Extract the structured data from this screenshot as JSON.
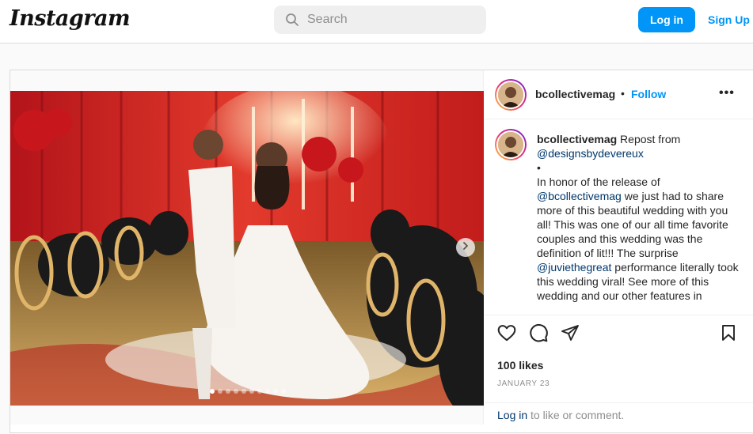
{
  "header": {
    "logo": "Instagram",
    "search_placeholder": "Search",
    "login_label": "Log in",
    "signup_label": "Sign Up"
  },
  "post": {
    "username": "bcollectivemag",
    "separator": "•",
    "follow_label": "Follow",
    "more_label": "•••",
    "caption": {
      "username": "bcollectivemag",
      "repost_prefix": " Repost from ",
      "repost_mention": "@designsbydevereux",
      "bullet": "•",
      "line1": "In honor of the release of ",
      "mention1": "@bcollectivemag",
      "line2": " we just had to share more of this beautiful wedding with you all! This was one of our all time favorite couples and this wedding was the definition of lit!!! The surprise ",
      "mention2": "@juviethegreat",
      "line3": " performance literally took this wedding viral! See more of this wedding and our other features in"
    },
    "likes": "100 likes",
    "date": "JANUARY 23",
    "comment_login": "Log in",
    "comment_suffix": " to like or comment.",
    "carousel_count": 10,
    "carousel_active": 1
  },
  "colors": {
    "brand_blue": "#0095f6",
    "mention": "#00376b",
    "muted": "#8e8e8e"
  },
  "icons": [
    "search-icon",
    "heart-icon",
    "comment-icon",
    "share-icon",
    "bookmark-icon",
    "chevron-right-icon",
    "more-icon"
  ]
}
